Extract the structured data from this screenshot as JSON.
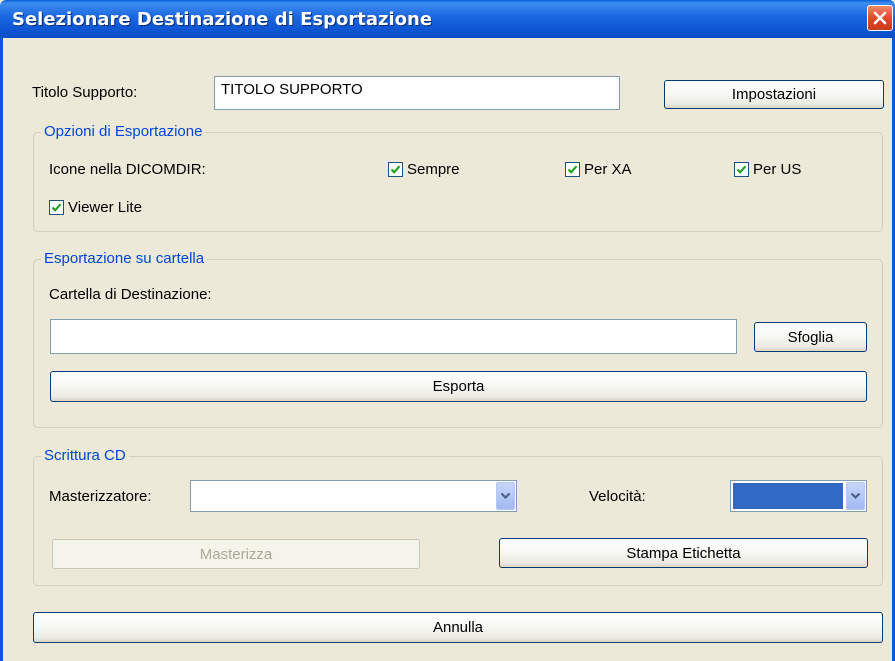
{
  "window": {
    "title": "Selezionare Destinazione di Esportazione"
  },
  "media": {
    "title_label": "Titolo Supporto:",
    "title_value": "TITOLO SUPPORTO",
    "settings_button": "Impostazioni"
  },
  "export_options": {
    "legend": "Opzioni di Esportazione",
    "icons_label": "Icone nella DICOMDIR:",
    "checkboxes": [
      {
        "label": "Sempre",
        "checked": true
      },
      {
        "label": "Per XA",
        "checked": true
      },
      {
        "label": "Per US",
        "checked": true
      },
      {
        "label": "Viewer Lite",
        "checked": true
      }
    ]
  },
  "folder_export": {
    "legend": "Esportazione su cartella",
    "dest_label": "Cartella di Destinazione:",
    "dest_value": "",
    "browse_button": "Sfoglia",
    "export_button": "Esporta"
  },
  "cd_write": {
    "legend": "Scrittura CD",
    "burner_label": "Masterizzatore:",
    "burner_value": "",
    "speed_label": "Velocità:",
    "burn_button": "Masterizza",
    "print_label_button": "Stampa Etichetta"
  },
  "footer": {
    "cancel_button": "Annulla"
  }
}
